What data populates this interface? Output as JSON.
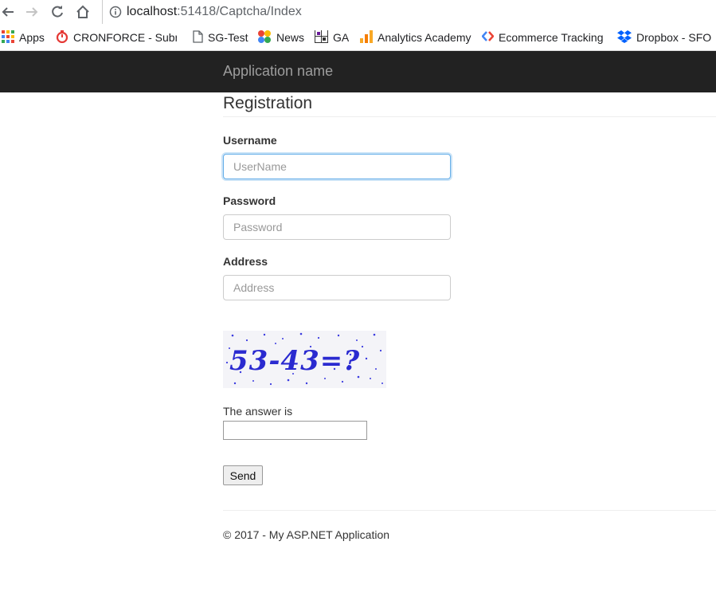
{
  "browser": {
    "url_host": "localhost",
    "url_path": ":51418/Captcha/Index",
    "bookmarks": [
      {
        "label": "Apps",
        "icon": "apps-grid-icon"
      },
      {
        "label": "CRONFORCE - Submi",
        "icon": "stopwatch-icon"
      },
      {
        "label": "SG-Test",
        "icon": "page-icon"
      },
      {
        "label": "News",
        "icon": "news-icon"
      },
      {
        "label": "GA",
        "icon": "ga-grid-icon"
      },
      {
        "label": "Analytics Academy",
        "icon": "analytics-icon"
      },
      {
        "label": "Ecommerce Tracking",
        "icon": "ecommerce-icon"
      },
      {
        "label": "Dropbox - SFO",
        "icon": "dropbox-icon"
      }
    ]
  },
  "navbar": {
    "brand": "Application name"
  },
  "form": {
    "title": "Registration",
    "username_label": "Username",
    "username_placeholder": "UserName",
    "password_label": "Password",
    "password_placeholder": "Password",
    "address_label": "Address",
    "address_placeholder": "Address",
    "captcha_text": "53-43=?",
    "answer_label": "The answer is",
    "send_label": "Send"
  },
  "footer": {
    "text": "© 2017 - My ASP.NET Application"
  },
  "colors": {
    "navbar": "#222222",
    "brand": "#9d9d9d",
    "captcha": "#2a2ad0"
  }
}
